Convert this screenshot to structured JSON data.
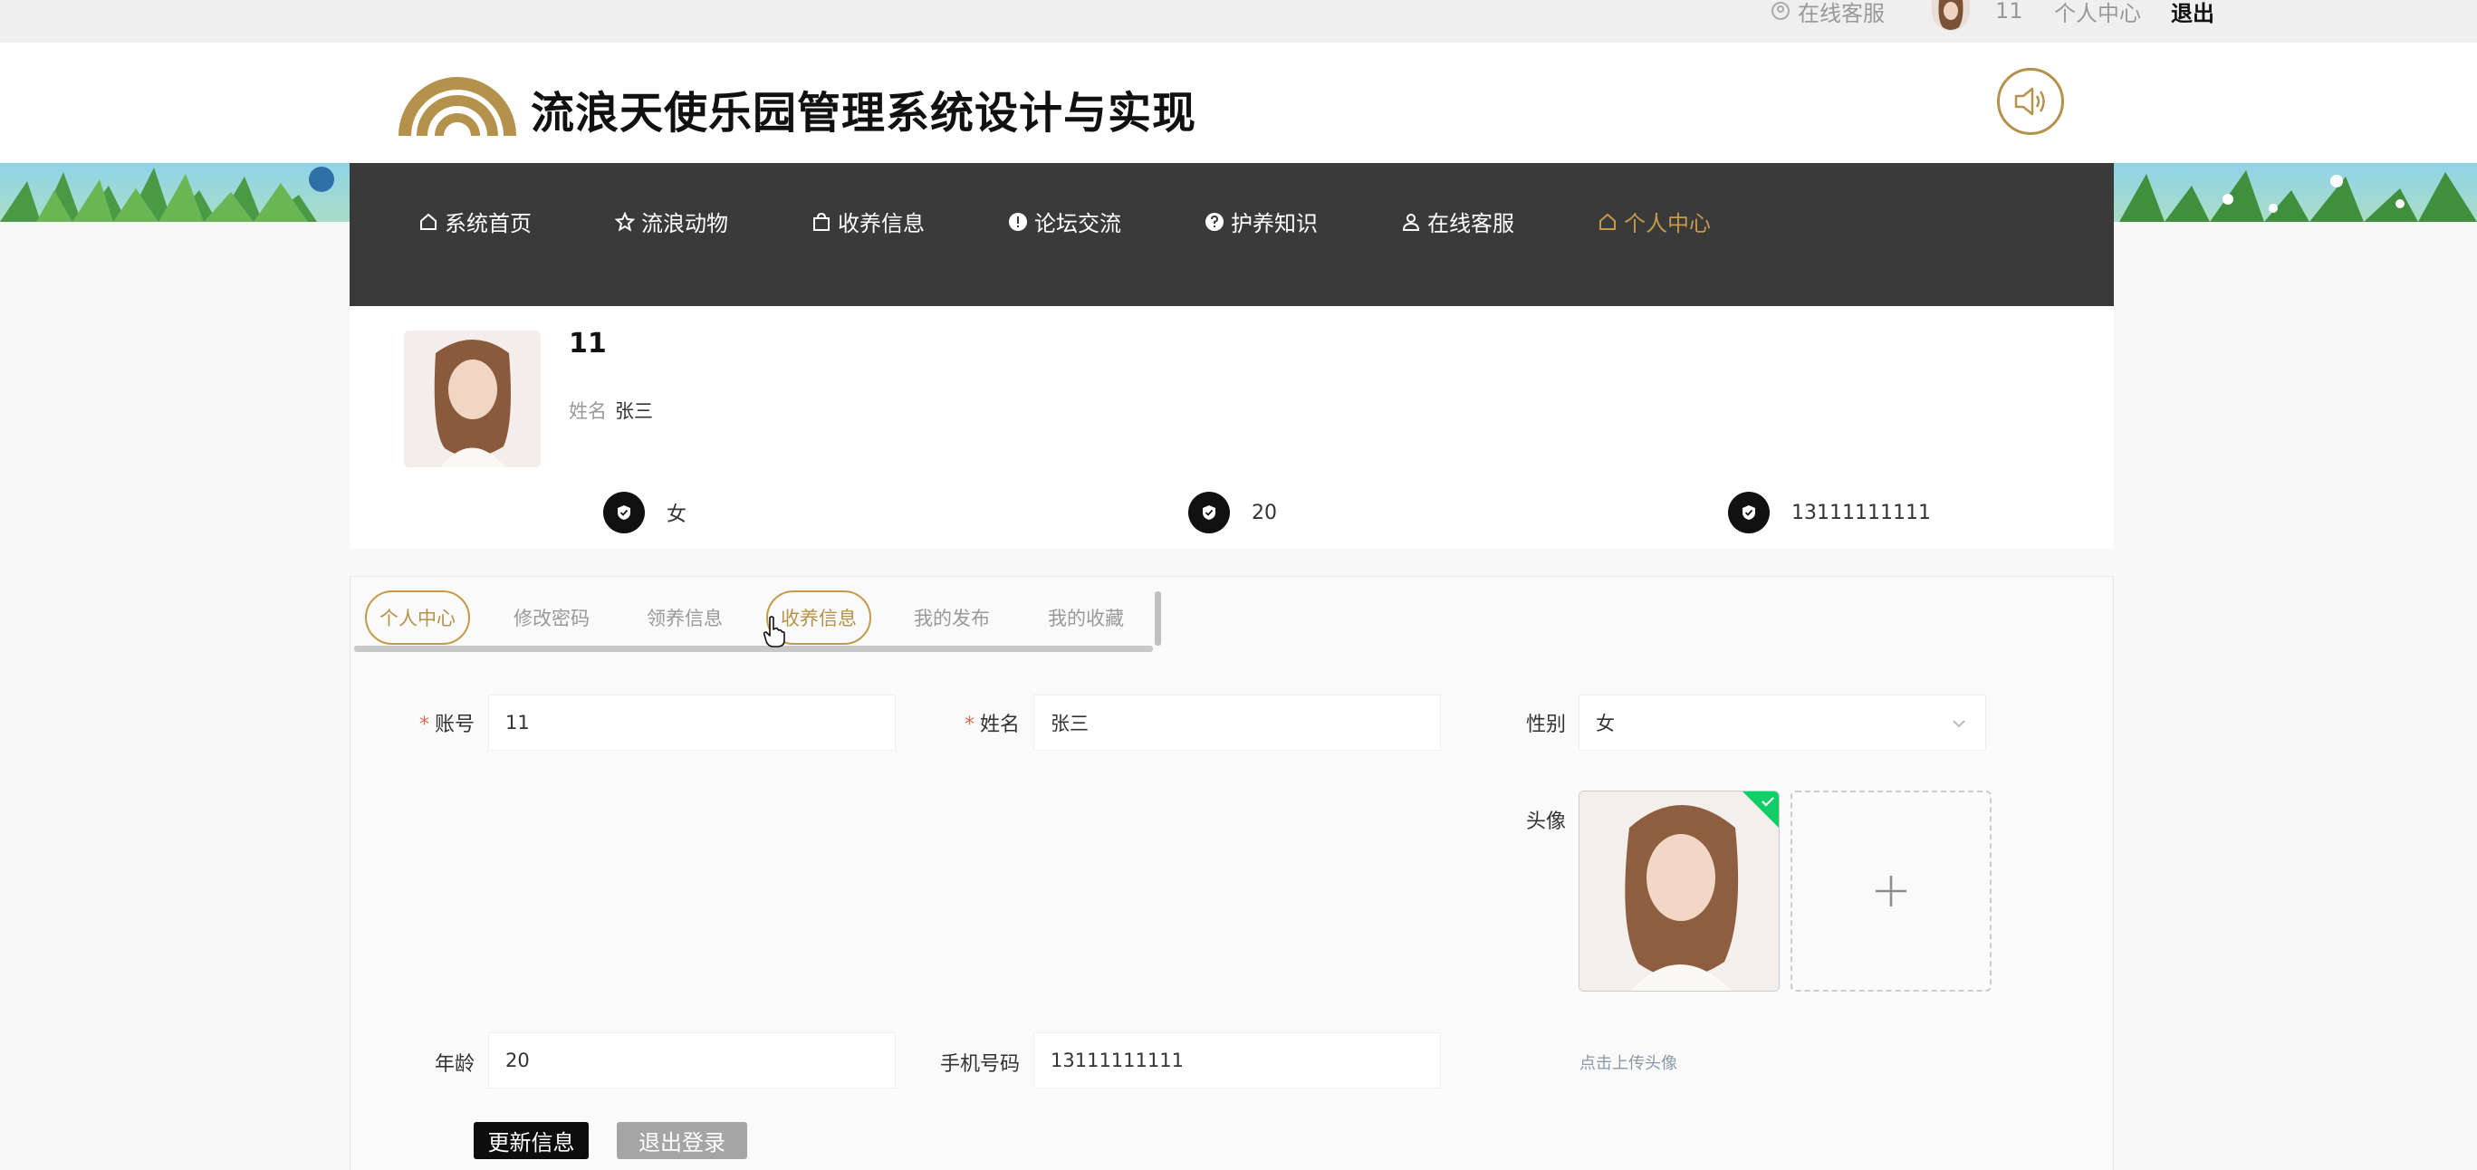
{
  "topbar": {
    "service": "在线客服",
    "username": "11",
    "center": "个人中心",
    "logout": "退出"
  },
  "header": {
    "title": "流浪天使乐园管理系统设计与实现"
  },
  "nav": [
    {
      "label": "系统首页",
      "icon": "home-icon"
    },
    {
      "label": "流浪动物",
      "icon": "star-icon"
    },
    {
      "label": "收养信息",
      "icon": "bag-icon"
    },
    {
      "label": "论坛交流",
      "icon": "alert-icon"
    },
    {
      "label": "护养知识",
      "icon": "help-icon"
    },
    {
      "label": "在线客服",
      "icon": "user-icon"
    },
    {
      "label": "个人中心",
      "icon": "home-icon",
      "active": true
    }
  ],
  "profile": {
    "username": "11",
    "name_label": "姓名",
    "name": "张三",
    "gender": "女",
    "age": "20",
    "phone": "13111111111"
  },
  "tabs": [
    {
      "label": "个人中心",
      "active": true
    },
    {
      "label": "修改密码"
    },
    {
      "label": "领养信息"
    },
    {
      "label": "收养信息",
      "hover": true
    },
    {
      "label": "我的发布"
    },
    {
      "label": "我的收藏"
    }
  ],
  "form": {
    "account_label": "账号",
    "account_value": "11",
    "name_label": "姓名",
    "name_value": "张三",
    "gender_label": "性别",
    "gender_value": "女",
    "avatar_label": "头像",
    "upload_tip": "点击上传头像",
    "age_label": "年龄",
    "age_value": "20",
    "phone_label": "手机号码",
    "phone_value": "13111111111",
    "update_button": "更新信息",
    "logout_button": "退出登录"
  },
  "colors": {
    "accent": "#c49a4a",
    "nav_bg": "#3a3a3a",
    "success": "#13ce66"
  }
}
